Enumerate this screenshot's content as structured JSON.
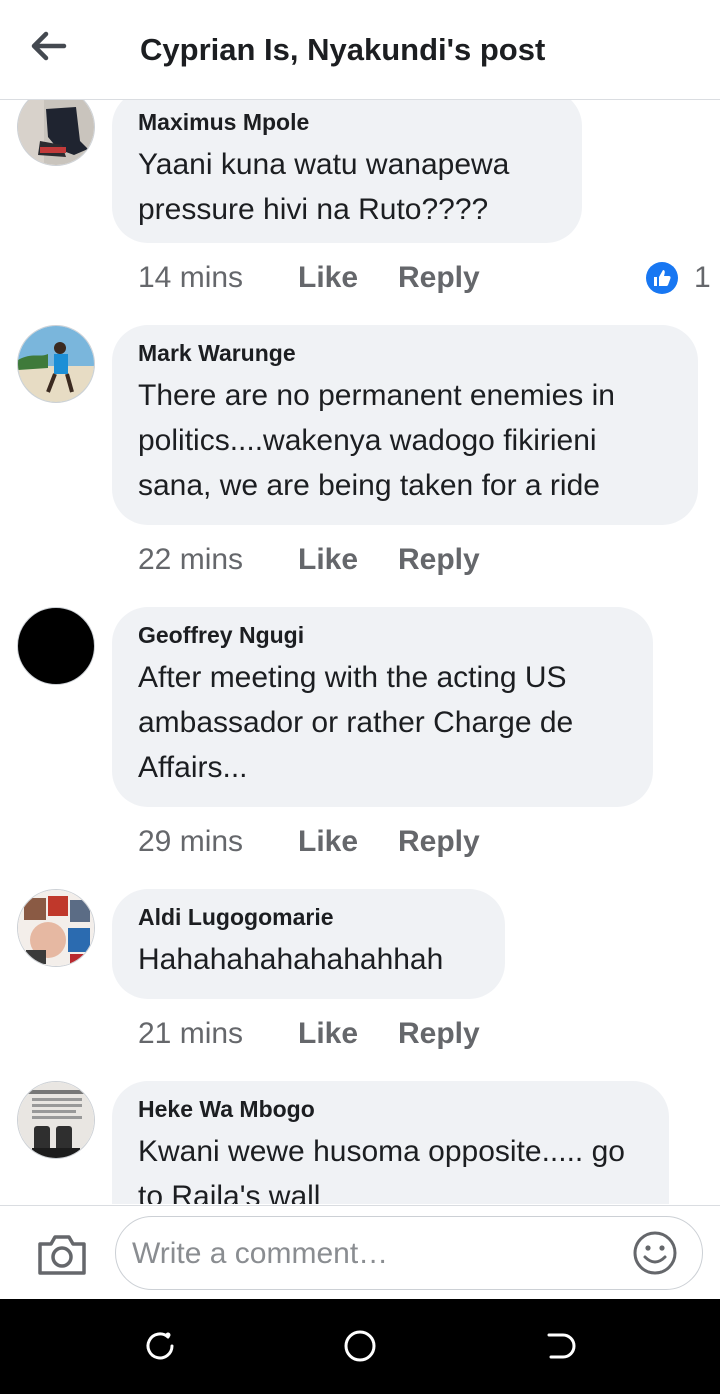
{
  "header": {
    "title": "Cyprian Is, Nyakundi's post",
    "back_icon": "arrow-left-icon"
  },
  "comments": [
    {
      "author": "Maximus Mpole",
      "text": "Yaani kuna watu wanapewa pressure hivi na Ruto????",
      "time": "14 mins",
      "like": "Like",
      "reply": "Reply",
      "reaction_count": "1",
      "reaction_icon": "thumbs-up-icon"
    },
    {
      "author": "Mark Warunge",
      "text": "There are no permanent enemies in politics....wakenya wadogo fikirieni sana,  we are being taken for a ride",
      "time": "22 mins",
      "like": "Like",
      "reply": "Reply"
    },
    {
      "author": "Geoffrey Ngugi",
      "text": "After meeting with the acting US ambassador or rather Charge de Affairs...",
      "time": "29 mins",
      "like": "Like",
      "reply": "Reply"
    },
    {
      "author": "Aldi Lugogomarie",
      "text": "Hahahahahahahahhah",
      "time": "21 mins",
      "like": "Like",
      "reply": "Reply"
    },
    {
      "author": "Heke Wa Mbogo",
      "text": "Kwani wewe husoma opposite..... go to Raila's wall"
    }
  ],
  "composer": {
    "placeholder": "Write a comment…",
    "camera_icon": "camera-icon",
    "emoji_icon": "emoji-icon"
  },
  "colors": {
    "like_blue": "#1877f2",
    "bubble_bg": "#f0f2f5",
    "meta_gray": "#65676b"
  }
}
